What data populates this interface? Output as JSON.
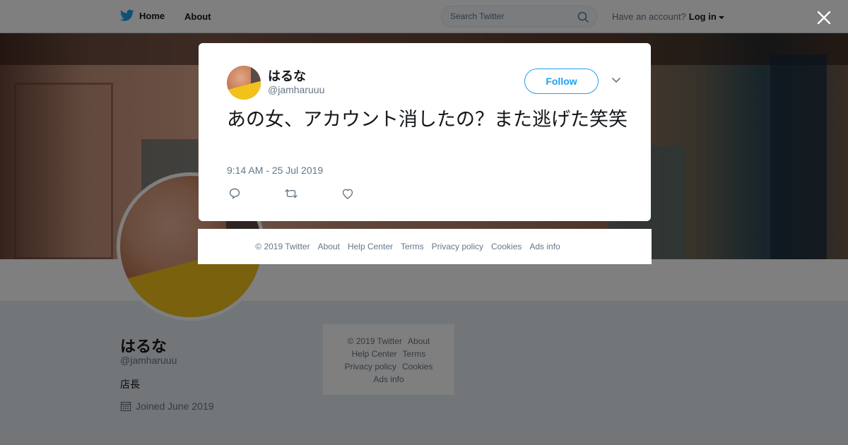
{
  "nav": {
    "home_label": "Home",
    "about_label": "About",
    "search_placeholder": "Search Twitter",
    "have_account_text": "Have an account?",
    "login_label": "Log in"
  },
  "profile": {
    "name": "はるな",
    "handle": "@jamharuuu",
    "bio": "店長",
    "joined": "Joined June 2019"
  },
  "side_footer": {
    "rows": [
      [
        "© 2019 Twitter",
        "About"
      ],
      [
        "Help Center",
        "Terms"
      ],
      [
        "Privacy policy",
        "Cookies"
      ],
      [
        "Ads info"
      ]
    ]
  },
  "tweet": {
    "author_name": "はるな",
    "author_handle": "@jamharuuu",
    "follow_label": "Follow",
    "text": "あの女、アカウント消したの？また逃げた笑笑",
    "timestamp": "9:14 AM - 25 Jul 2019",
    "actions": [
      "reply-icon",
      "retweet-icon",
      "like-icon"
    ]
  },
  "modal_footer": {
    "links": [
      "© 2019 Twitter",
      "About",
      "Help Center",
      "Terms",
      "Privacy policy",
      "Cookies",
      "Ads info"
    ]
  },
  "colors": {
    "accent": "#1da1f2",
    "text_primary": "#14171a",
    "text_secondary": "#657786"
  }
}
